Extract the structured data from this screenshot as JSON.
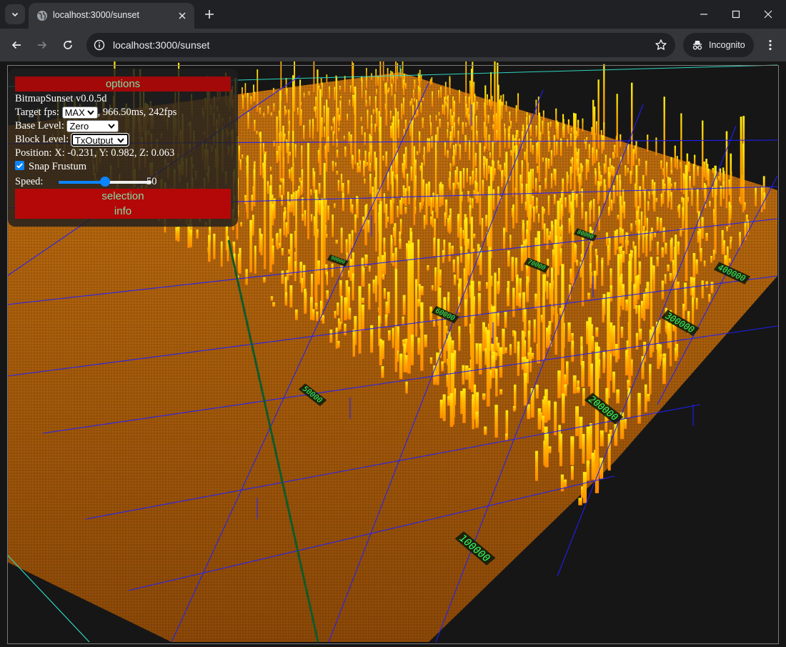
{
  "browser": {
    "tab_title": "localhost:3000/sunset",
    "url": "localhost:3000/sunset",
    "profile_label": "Incognito"
  },
  "panel": {
    "options_label": "options",
    "version": "BitmapSunset v0.0.5d",
    "target_fps_label": "Target fps:",
    "target_fps_value": "MAX",
    "frame_stats": ", 966.50ms, 242fps",
    "base_level_label": "Base Level:",
    "base_level_value": "Zero",
    "block_level_label": "Block Level:",
    "block_level_value": "TxOutput",
    "position": "Position: X: -0.231, Y: 0.982, Z: 0.063",
    "snap_frustum_label": "Snap Frustum",
    "snap_frustum_checked": true,
    "speed_label": "Speed:",
    "speed_value": "50",
    "speed_fraction": 0.5,
    "selection_label": "selection",
    "info_label": "info"
  },
  "scene": {
    "block_labels": [
      "100000",
      "200000",
      "300000",
      "400000",
      "50000",
      "60000",
      "70000",
      "80000",
      "90000"
    ],
    "colors": {
      "floor": "#a4560c",
      "bar_base": "#ff9a00",
      "bar_top": "#ffe600",
      "grid_lines": "#2020ff",
      "axis_lines": "#2ee0c8",
      "label_text": "#33ff66"
    }
  }
}
